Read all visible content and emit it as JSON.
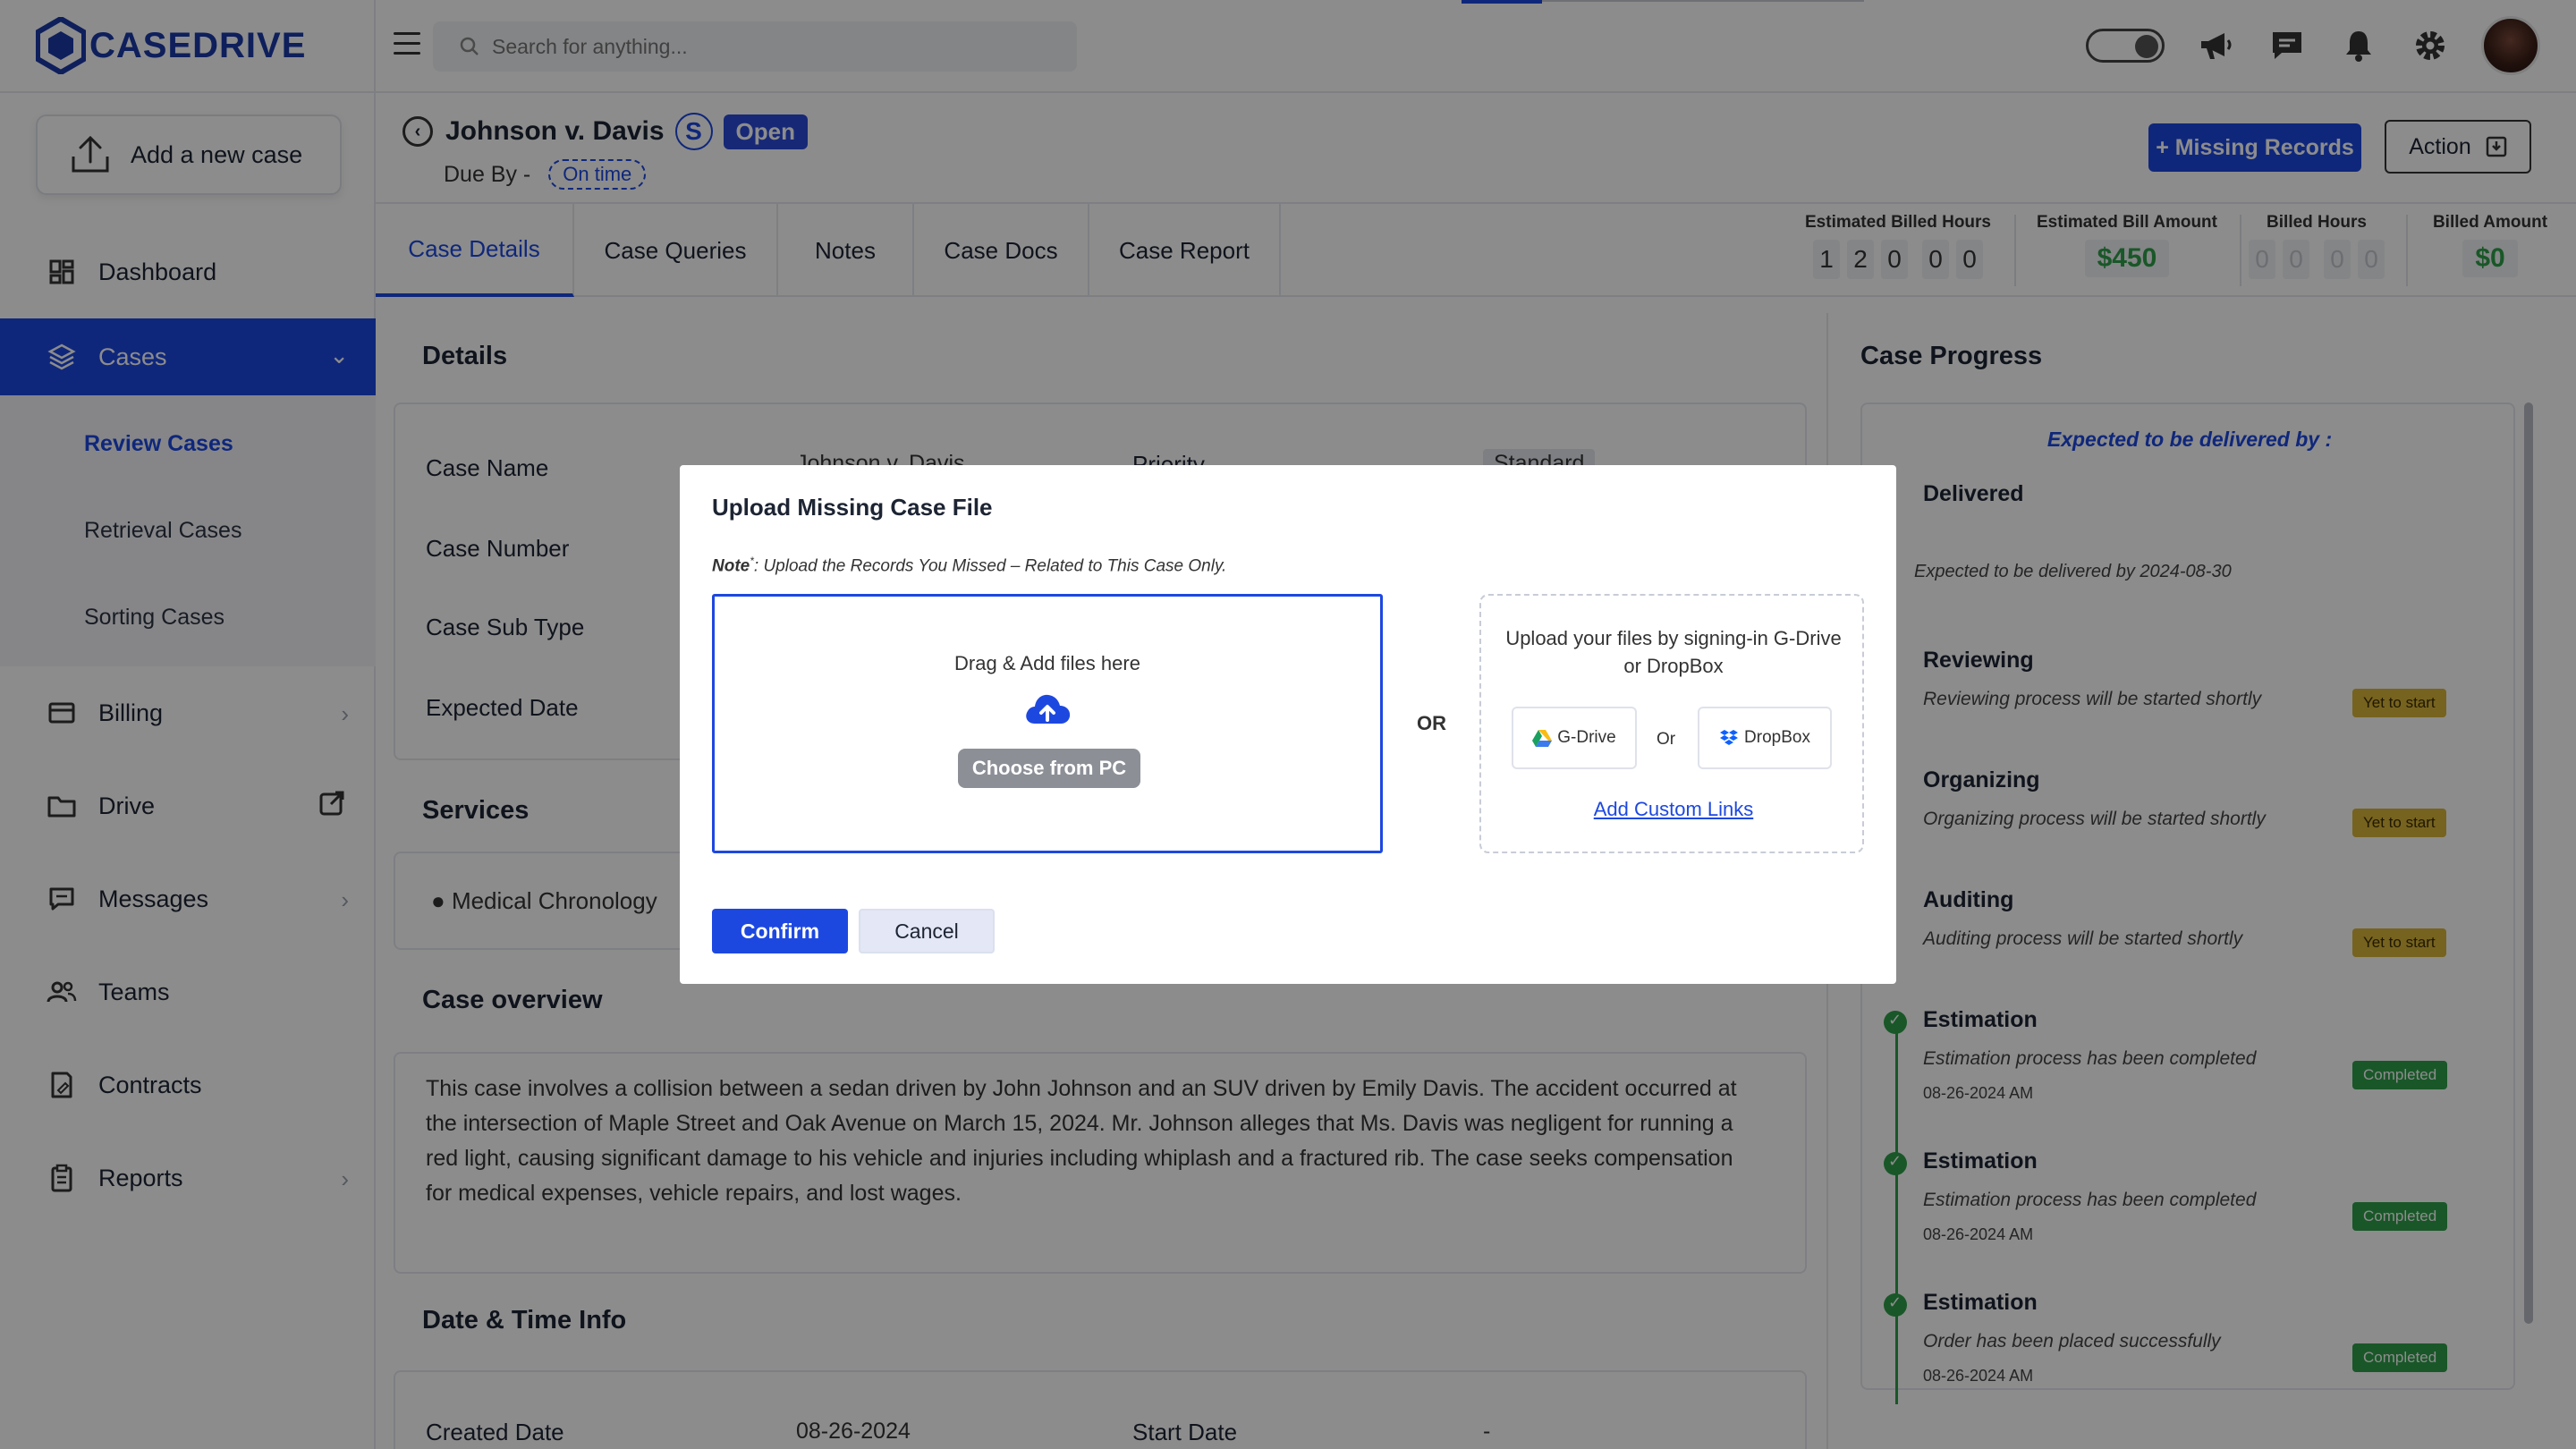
{
  "brand": {
    "name": "CASEDRIVE",
    "color": "#1a3aa8"
  },
  "colors": {
    "primary": "#1d48e0",
    "success": "#2f9e4a",
    "warning": "#d8b43a"
  },
  "sidebar": {
    "add_case": "Add a new case",
    "items": [
      {
        "label": "Dashboard",
        "icon": "dashboard-icon"
      },
      {
        "label": "Cases",
        "icon": "layers-icon"
      },
      {
        "label": "Billing",
        "icon": "credit-card-icon"
      },
      {
        "label": "Drive",
        "icon": "folder-icon"
      },
      {
        "label": "Messages",
        "icon": "message-icon"
      },
      {
        "label": "Teams",
        "icon": "users-icon"
      },
      {
        "label": "Contracts",
        "icon": "contract-icon"
      },
      {
        "label": "Reports",
        "icon": "clipboard-icon"
      }
    ],
    "cases_sub": [
      "Review Cases",
      "Retrieval Cases",
      "Sorting Cases"
    ]
  },
  "search": {
    "placeholder": "Search for anything..."
  },
  "case": {
    "title": "Johnson v. Davis",
    "badge_letter": "S",
    "status": "Open",
    "due_label": "Due By -",
    "due_status": "On time",
    "missing_records_btn": "+ Missing Records",
    "action_btn": "Action"
  },
  "tabs": [
    "Case Details",
    "Case Queries",
    "Notes",
    "Case Docs",
    "Case Report"
  ],
  "stats": {
    "est_hours_label": "Estimated Billed Hours",
    "est_hours_digits": [
      "1",
      "2",
      "0",
      "0",
      "0"
    ],
    "est_amount_label": "Estimated Bill Amount",
    "est_amount": "$450",
    "billed_hours_label": "Billed Hours",
    "billed_hours_digits": [
      "0",
      "0",
      "0",
      "0"
    ],
    "billed_amount_label": "Billed Amount",
    "billed_amount": "$0"
  },
  "details": {
    "title": "Details",
    "rows": [
      {
        "label": "Case Name",
        "value": "Johnson v. Davis"
      },
      {
        "label": "Case Number",
        "value": ""
      },
      {
        "label": "Case Sub Type",
        "value": ""
      },
      {
        "label": "Expected Date",
        "value": ""
      }
    ],
    "priority_label": "Priority",
    "priority_value": "Standard"
  },
  "services": {
    "title": "Services",
    "item": "Medical Chronology"
  },
  "overview": {
    "title": "Case overview",
    "text": "This case involves a collision between a sedan driven by John Johnson and an SUV driven by Emily Davis. The accident occurred at the intersection of Maple Street and Oak Avenue on March 15, 2024. Mr. Johnson alleges that Ms. Davis was negligent for running a red light, causing significant damage to his vehicle and injuries including whiplash and a fractured rib. The case seeks compensation for medical expenses, vehicle repairs, and lost wages."
  },
  "datetime": {
    "title": "Date & Time Info",
    "created_label": "Created Date",
    "created_value": "08-26-2024",
    "start_label": "Start Date",
    "start_value": "-"
  },
  "progress": {
    "title": "Case Progress",
    "expected_header": "Expected to be delivered by :",
    "delivered": {
      "name": "Delivered",
      "note": "Expected to be delivered by 2024-08-30"
    },
    "steps": [
      {
        "name": "Reviewing",
        "desc": "Reviewing process will be started shortly",
        "status": "Yet to start"
      },
      {
        "name": "Organizing",
        "desc": "Organizing process will be started shortly",
        "status": "Yet to start"
      },
      {
        "name": "Auditing",
        "desc": "Auditing process will be started shortly",
        "status": "Yet to start"
      },
      {
        "name": "Estimation",
        "desc": "Estimation process has been completed",
        "date": "08-26-2024 AM",
        "status": "Completed"
      },
      {
        "name": "Estimation",
        "desc": "Estimation process has been completed",
        "date": "08-26-2024 AM",
        "status": "Completed"
      },
      {
        "name": "Estimation",
        "desc": "Order has been placed successfully",
        "date": "08-26-2024 AM",
        "status": "Completed"
      }
    ]
  },
  "modal": {
    "title": "Upload Missing Case File",
    "note_label": "Note",
    "note_text": ": Upload the Records You Missed – Related to This Case Only.",
    "drag_text": "Drag & Add files here",
    "choose_btn": "Choose from PC",
    "or": "OR",
    "cloud_text": "Upload your files by signing-in G-Drive or DropBox",
    "gdrive": "G-Drive",
    "small_or": "Or",
    "dropbox": "DropBox",
    "custom_links": "Add Custom Links",
    "confirm": "Confirm",
    "cancel": "Cancel"
  }
}
